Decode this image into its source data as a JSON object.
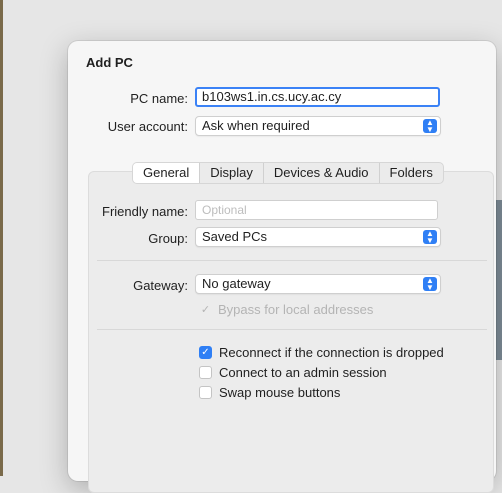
{
  "dialog": {
    "title": "Add PC",
    "pc_name": {
      "label": "PC name:",
      "value": "b103ws1.in.cs.ucy.ac.cy"
    },
    "user_account": {
      "label": "User account:",
      "value": "Ask when required"
    }
  },
  "tabs": [
    {
      "label": "General"
    },
    {
      "label": "Display"
    },
    {
      "label": "Devices & Audio"
    },
    {
      "label": "Folders"
    }
  ],
  "general": {
    "friendly_name": {
      "label": "Friendly name:",
      "placeholder": "Optional"
    },
    "group": {
      "label": "Group:",
      "value": "Saved PCs"
    },
    "gateway": {
      "label": "Gateway:",
      "value": "No gateway"
    },
    "bypass": {
      "label": "Bypass for local addresses",
      "checked": true,
      "disabled": true
    },
    "options": [
      {
        "label": "Reconnect if the connection is dropped",
        "checked": true
      },
      {
        "label": "Connect to an admin session",
        "checked": false
      },
      {
        "label": "Swap mouse buttons",
        "checked": false
      }
    ]
  },
  "colors": {
    "accent": "#2f7ff5",
    "focus_ring": "#3b82f6"
  }
}
